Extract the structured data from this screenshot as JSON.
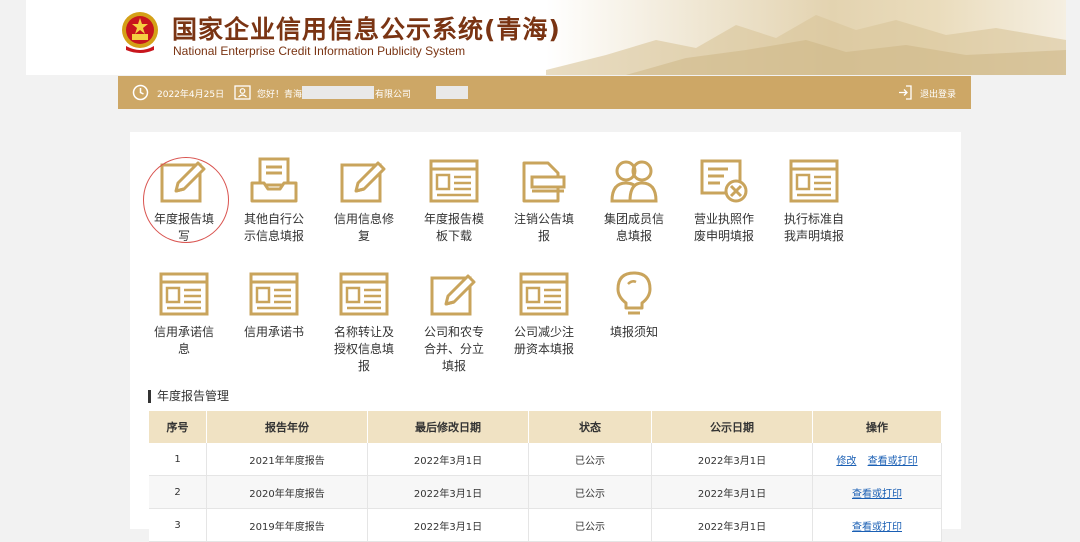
{
  "header": {
    "title": "国家企业信用信息公示系统(青海)",
    "subtitle": "National Enterprise Credit Information Publicity System"
  },
  "topbar": {
    "date": "2022年4月25日",
    "greeting": "您好！青海",
    "company_suffix": "有限公司",
    "logout": "退出登录"
  },
  "tiles": [
    {
      "label": "年度报告填写",
      "icon": "pencil-edit-icon"
    },
    {
      "label": "其他自行公示信息填报",
      "icon": "inbox-document-icon"
    },
    {
      "label": "信用信息修复",
      "icon": "pencil-edit-icon"
    },
    {
      "label": "年度报告模板下载",
      "icon": "form-window-icon"
    },
    {
      "label": "注销公告填报",
      "icon": "document-stack-icon"
    },
    {
      "label": "集团成员信息填报",
      "icon": "group-users-icon"
    },
    {
      "label": "营业执照作废申明填报",
      "icon": "license-cancel-icon"
    },
    {
      "label": "执行标准自我声明填报",
      "icon": "form-window-icon"
    },
    {
      "label": "信用承诺信息",
      "icon": "form-window-icon"
    },
    {
      "label": "信用承诺书",
      "icon": "form-window-icon"
    },
    {
      "label": "名称转让及授权信息填报",
      "icon": "form-window-icon"
    },
    {
      "label": "公司和农专合并、分立填报",
      "icon": "pencil-edit-icon"
    },
    {
      "label": "公司减少注册资本填报",
      "icon": "form-window-icon"
    },
    {
      "label": "填报须知",
      "icon": "lightbulb-icon"
    }
  ],
  "section_title": "年度报告管理",
  "table": {
    "headers": [
      "序号",
      "报告年份",
      "最后修改日期",
      "状态",
      "公示日期",
      "操作"
    ],
    "rows": [
      {
        "no": "1",
        "year": "2021年年度报告",
        "modified": "2022年3月1日",
        "status": "已公示",
        "published": "2022年3月1日",
        "actions": [
          "修改",
          "查看或打印"
        ]
      },
      {
        "no": "2",
        "year": "2020年年度报告",
        "modified": "2022年3月1日",
        "status": "已公示",
        "published": "2022年3月1日",
        "actions": [
          "查看或打印"
        ]
      },
      {
        "no": "3",
        "year": "2019年年度报告",
        "modified": "2022年3月1日",
        "status": "已公示",
        "published": "2022年3月1日",
        "actions": [
          "查看或打印"
        ]
      }
    ]
  },
  "colors": {
    "gold": "#cda766",
    "icon_gold": "#c9a45c",
    "title_brown": "#7a3413",
    "table_header": "#f0e2c3",
    "link_blue": "#1a5fb4",
    "highlight_red": "#d9534f"
  }
}
